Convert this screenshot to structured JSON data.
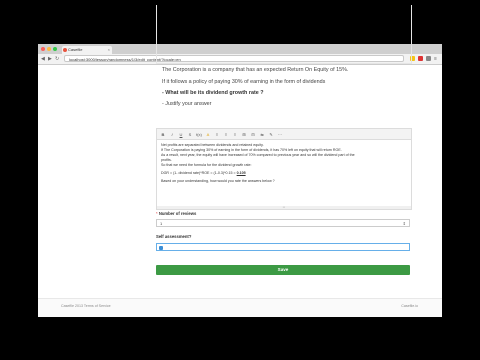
{
  "browser": {
    "tab_title": "Casefile",
    "url": "localhost:3000/lesson/randomness/1/3/edit_content/?locale=en",
    "colors": {
      "close": "#fc605b",
      "minimize": "#fdbc40",
      "maximize": "#34c84a"
    }
  },
  "question": {
    "line1": "The Corporation is a company that has an expected Return On Equity of 15%.",
    "line2": "If it follows a policy of paying 30% of earning in the form of dividends",
    "bullet1": "- What will be its dividend growth rate ?",
    "bullet2": "- Justify your answer"
  },
  "editor": {
    "toolbar": [
      "B",
      "I",
      "U",
      "S",
      "f(x)",
      "A",
      "≡",
      "≡",
      "≡",
      "⊞",
      "⊟",
      "⇆",
      "✎",
      "⋯"
    ],
    "lines": [
      "Net profits are separated between dividends and retained equity.",
      "If The Corporation is paying 30% of earning in the form of dividends, it has 70% left on equity that will return ROE.",
      "As a result, next year, the equity will have increased of 70% compared to previous year and so will the dividend part of the",
      "profits.",
      "So that we need the formula for the dividend growth rate:"
    ],
    "formula_prefix": "DGR = (1- dividend rate)*ROE = (1-0.3)*0.15 = ",
    "formula_answer": "0.105",
    "prompt": "Based on your understanding, how would you rate the answers below ?"
  },
  "form": {
    "reviews_label": "Number of reviews",
    "reviews_required_mark": "*",
    "reviews_value": "1",
    "self_assessment_label": "Self assessment?",
    "self_assessment_checked": true,
    "save_label": "Save"
  },
  "footer": {
    "left": "Casefile 2013 Terms of Service",
    "right": "Casefile.io"
  }
}
